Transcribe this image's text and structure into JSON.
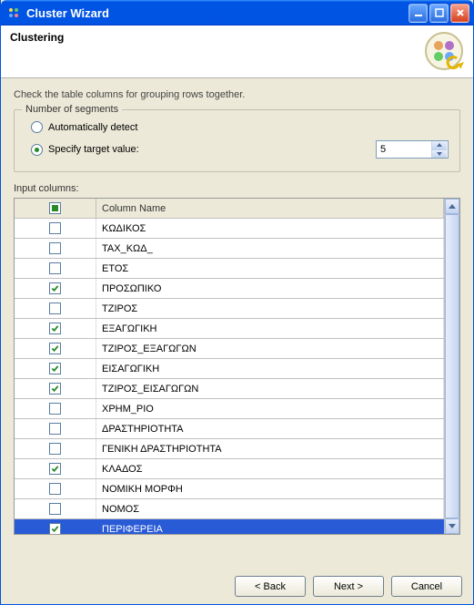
{
  "window": {
    "title": "Cluster Wizard"
  },
  "header": {
    "heading": "Clustering"
  },
  "instruction": "Check the table columns for grouping rows together.",
  "segments": {
    "group_label": "Number of segments",
    "auto_label": "Automatically detect",
    "target_label": "Specify target value:",
    "selected": "target",
    "target_value": "5"
  },
  "table": {
    "section_label": "Input columns:",
    "header_col_name": "Column Name",
    "rows": [
      {
        "checked": false,
        "name": "ΚΩΔΙΚΟΣ"
      },
      {
        "checked": false,
        "name": "ΤΑΧ_ΚΩΔ_"
      },
      {
        "checked": false,
        "name": "ΕΤΟΣ"
      },
      {
        "checked": true,
        "name": "ΠΡΟΣΩΠΙΚΟ"
      },
      {
        "checked": false,
        "name": "ΤΖΙΡΟΣ"
      },
      {
        "checked": true,
        "name": "ΕΞΑΓΩΓΙΚΗ"
      },
      {
        "checked": true,
        "name": "ΤΖΙΡΟΣ_ΕΞΑΓΩΓΩΝ"
      },
      {
        "checked": true,
        "name": "ΕΙΣΑΓΩΓΙΚΗ"
      },
      {
        "checked": true,
        "name": "ΤΖΙΡΟΣ_ΕΙΣΑΓΩΓΩΝ"
      },
      {
        "checked": false,
        "name": "ΧΡΗΜ_ΡΙΟ"
      },
      {
        "checked": false,
        "name": "ΔΡΑΣΤΗΡΙΟΤΗΤΑ"
      },
      {
        "checked": false,
        "name": "ΓΕΝΙΚΗ ΔΡΑΣΤΗΡΙΟΤΗΤΑ"
      },
      {
        "checked": true,
        "name": "ΚΛΑΔΟΣ"
      },
      {
        "checked": false,
        "name": "ΝΟΜΙΚΗ ΜΟΡΦΗ"
      },
      {
        "checked": false,
        "name": "ΝΟΜΟΣ"
      },
      {
        "checked": true,
        "name": "ΠΕΡΙΦΕΡΕΙΑ",
        "selected": true
      }
    ]
  },
  "buttons": {
    "back": "< Back",
    "next": "Next >",
    "cancel": "Cancel"
  }
}
